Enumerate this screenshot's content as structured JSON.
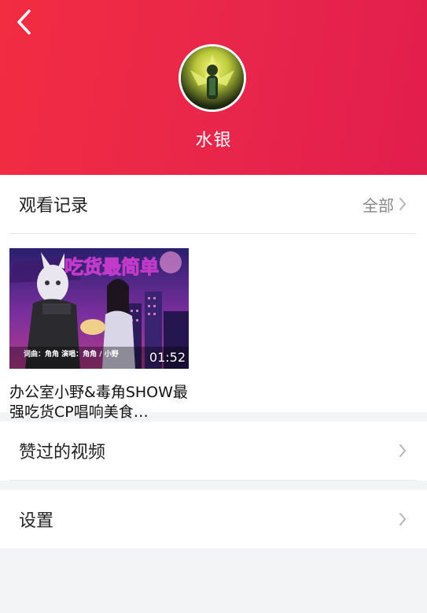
{
  "header": {
    "username": "水银",
    "avatar_desc": "user avatar image"
  },
  "history": {
    "title": "观看记录",
    "all_label": "全部",
    "videos": [
      {
        "title": "办公室小野&毒角SHOW最强吃货CP唱响美食…",
        "duration": "01:52",
        "thumb_text": "吃货最简单",
        "thumb_credits": "词曲：角角   演唱：角角 / 小野"
      }
    ]
  },
  "menu": {
    "liked_videos_label": "赞过的视频",
    "settings_label": "设置"
  },
  "colors": {
    "header_gradient_start": "#f22c41",
    "header_gradient_end": "#e21d4c",
    "page_background": "#f3f4f6"
  }
}
